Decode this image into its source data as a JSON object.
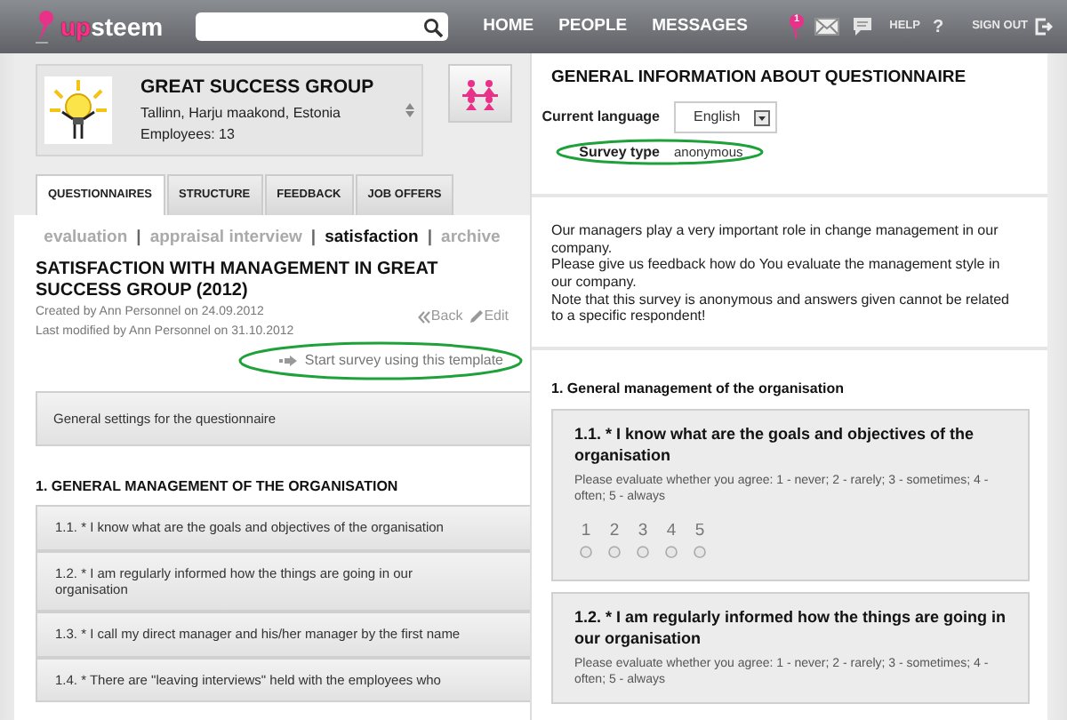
{
  "header": {
    "logo": [
      {
        "text": "up",
        "kind": "accent"
      },
      {
        "text": "steem",
        "kind": "plain"
      }
    ],
    "nav": [
      "HOME",
      "PEOPLE",
      "MESSAGES"
    ],
    "notification_count": "1",
    "help": "HELP",
    "help_icon": "?",
    "sign_out": "SIGN OUT"
  },
  "company": {
    "name": "GREAT SUCCESS GROUP",
    "location": "Tallinn, Harju maakond, Estonia",
    "employees": "Employees: 13"
  },
  "tabs": [
    {
      "label": "QUESTIONNAIRES",
      "selected": true
    },
    {
      "label": "STRUCTURE",
      "selected": false
    },
    {
      "label": "FEEDBACK",
      "selected": false
    },
    {
      "label": "JOB OFFERS",
      "selected": false
    }
  ],
  "subnav": [
    {
      "label": "evaluation",
      "selected": false
    },
    {
      "label": "appraisal interview",
      "selected": false
    },
    {
      "label": "satisfaction",
      "selected": true
    },
    {
      "label": "archive",
      "selected": false
    }
  ],
  "subnav_separator": "|",
  "survey": {
    "title": "SATISFACTION WITH MANAGEMENT IN GREAT SUCCESS GROUP (2012)",
    "created": "Created by Ann Personnel on 24.09.2012",
    "modified": "Last modified by Ann Personnel on 31.10.2012",
    "back": "Back",
    "edit": "Edit",
    "start": {
      "label": "Start survey using this template",
      "highlighted": true
    }
  },
  "settings": "General settings for the questionnaire",
  "section_heading": "1. GENERAL MANAGEMENT OF THE ORGANISATION",
  "questions": [
    "1.1. * I know what are the goals and objectives of the organisation",
    "1.2. * I am regularly informed how the things are going in our organisation",
    "1.3. * I call my direct manager and his/her manager by the first name",
    "1.4. * There are \"leaving interviews\" held with the employees who"
  ],
  "info": {
    "title": "GENERAL INFORMATION ABOUT QUESTIONNAIRE",
    "language_label": "Current language",
    "language": "English",
    "survey_type_label": "Survey type",
    "survey_type": "anonymous",
    "highlighted": true
  },
  "intro": [
    "Our managers play a very important role in change management in our company.",
    "Please give us feedback how do You evaluate the management style in our company.",
    "Note that this survey is anonymous and answers given cannot be related to a specific respondent!"
  ],
  "section_title": "1. General management of the organisation",
  "question_cards": [
    {
      "title": "1.1. * I know what are the goals and objectives of the organisation",
      "hint": "Please evaluate whether you agree: 1 - never; 2 - rarely; 3 - sometimes; 4 - often; 5 - always",
      "options": [
        {
          "label": "1",
          "selected": false
        },
        {
          "label": "2",
          "selected": false
        },
        {
          "label": "3",
          "selected": false
        },
        {
          "label": "4",
          "selected": false
        },
        {
          "label": "5",
          "selected": false
        }
      ]
    },
    {
      "title": "1.2. * I am regularly informed how the things are going in our organisation",
      "hint": "Please evaluate whether you agree: 1 - never; 2 - rarely; 3 - sometimes; 4 - often; 5 - always"
    }
  ]
}
